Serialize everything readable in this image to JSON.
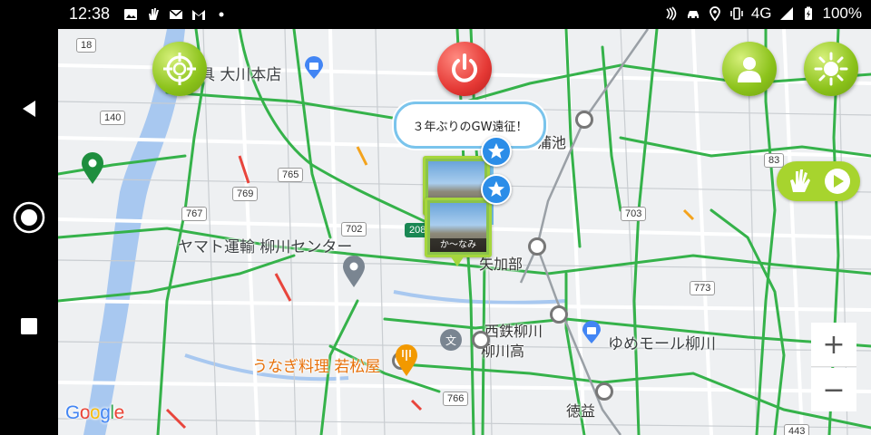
{
  "status_bar": {
    "time": "12:38",
    "network": "4G",
    "battery": "100%",
    "left_icons": [
      "image-icon",
      "gesture-hand-icon",
      "mail-icon",
      "gmail-icon",
      "dot-icon"
    ],
    "right_icons": [
      "nfc-icon",
      "car-icon",
      "location-icon",
      "vibrate-icon",
      "signal-icon",
      "battery-icon"
    ]
  },
  "nav": {
    "buttons": [
      "back-icon",
      "home-icon",
      "recents-icon"
    ]
  },
  "map": {
    "places": {
      "store_top": "具 大川本店",
      "yamato": "ヤマト運輸 柳川センター",
      "unagi": "うなぎ料理 若松屋",
      "youme": "ゆめモール柳川"
    },
    "stations": {
      "kamachi": "蒲池",
      "yakabe": "矢加部",
      "nishitetsu_yanagawa": "西鉄柳川",
      "tokumasu": "徳益",
      "yanagawa_high": "柳川高"
    },
    "routes": [
      "18",
      "140",
      "765",
      "769",
      "767",
      "702",
      "208",
      "703",
      "83",
      "773",
      "766",
      "443"
    ],
    "attribution": "Google"
  },
  "controls": {
    "locate_button": "crosshair-icon",
    "power_button": "power-icon",
    "user_button": "user-icon",
    "brightness_button": "sun-icon",
    "gesture_toggle": [
      "hand-icon",
      "play-icon"
    ],
    "zoom_in": "+",
    "zoom_out": "−"
  },
  "post": {
    "bubble_text": "３年ぶりのGW遠征！",
    "photo_caption": "か～なみ"
  },
  "colors": {
    "accent_green": "#8bc21a",
    "power_red": "#e53935",
    "star_blue": "#2b8de8",
    "road_green": "#35b24a",
    "river": "#a8c8f0"
  }
}
